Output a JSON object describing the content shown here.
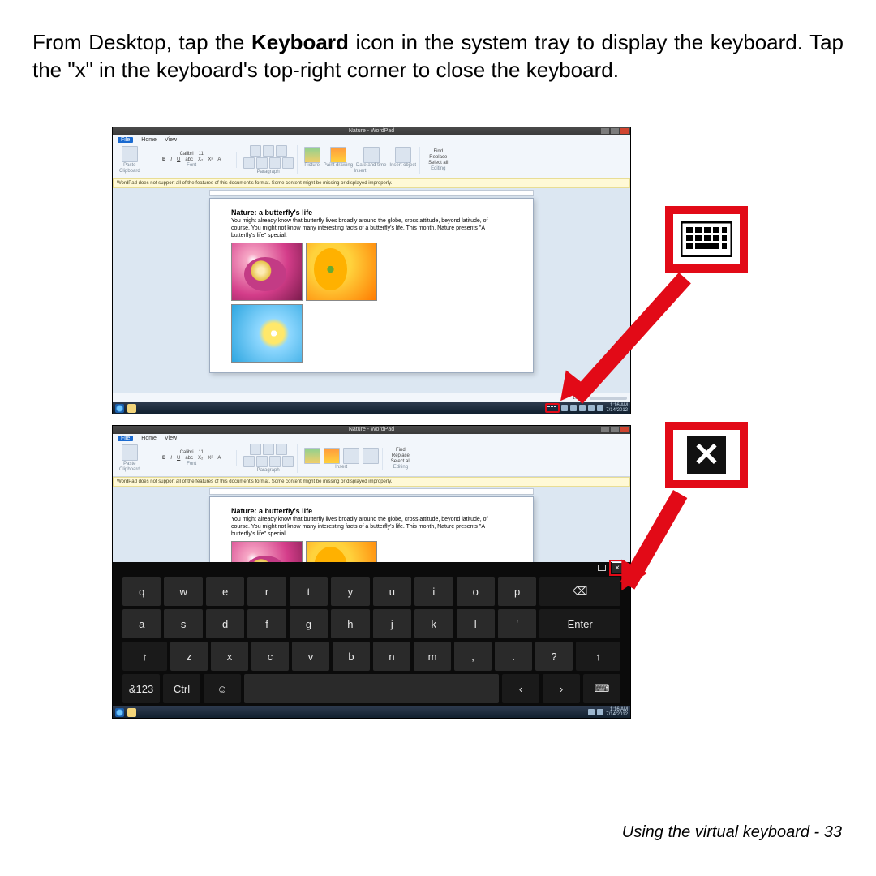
{
  "instruction": {
    "pre": "From Desktop, tap the ",
    "bold": "Keyboard",
    "post": " icon in the system tray to display the keyboard. Tap the \"x\" in the keyboard's top-right corner to close the keyboard."
  },
  "footer": "Using the virtual keyboard -  33",
  "window": {
    "title": "Nature - WordPad",
    "tabs": {
      "file": "File",
      "home": "Home",
      "view": "View"
    },
    "ribbon": {
      "paste": "Paste",
      "clipboard": "Clipboard",
      "font_name": "Calibri",
      "font_size": "11",
      "font": "Font",
      "paragraph": "Paragraph",
      "picture": "Picture",
      "paint": "Paint drawing",
      "date": "Date and time",
      "object": "Insert object",
      "insert": "Insert",
      "find": "Find",
      "replace": "Replace",
      "select_all": "Select all",
      "editing": "Editing"
    },
    "warning": "WordPad does not support all of the features of this document's format. Some content might be missing or displayed improperly.",
    "zoom": "100%"
  },
  "document": {
    "title": "Nature: a butterfly's life",
    "paragraph": "You might already know that butterfly lives broadly around the globe, cross attitude, beyond latitude, of course. You might not know many interesting facts of a butterfly's life. This month, Nature presents \"A butterfly's life\" special."
  },
  "taskbar": {
    "time": "1:16 AM",
    "date": "7/14/2012"
  },
  "callouts": {
    "keyboard_icon": "keyboard-icon",
    "close_x": "✕"
  },
  "osk": {
    "row1": [
      "q",
      "w",
      "e",
      "r",
      "t",
      "y",
      "u",
      "i",
      "o",
      "p"
    ],
    "backspace": "⌫",
    "row2": [
      "a",
      "s",
      "d",
      "f",
      "g",
      "h",
      "j",
      "k",
      "l",
      "'"
    ],
    "enter": "Enter",
    "row3_shift": "↑",
    "row3": [
      "z",
      "x",
      "c",
      "v",
      "b",
      "n",
      "m",
      ",",
      ".",
      "?"
    ],
    "row4": {
      "sym": "&123",
      "ctrl": "Ctrl",
      "emoji": "☺",
      "left": "‹",
      "right": "›",
      "kbd": "⌨"
    }
  }
}
